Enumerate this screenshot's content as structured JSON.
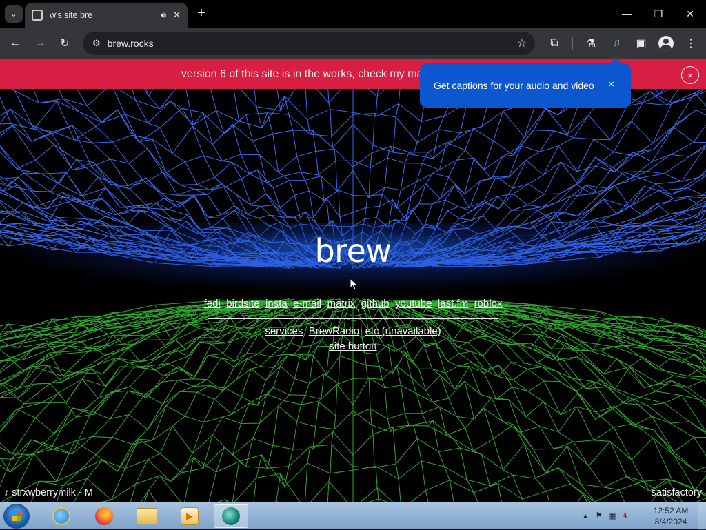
{
  "browser": {
    "tab_title": "w's site bre",
    "url": "brew.rocks",
    "tab_icons": {
      "audio": "speaker-icon",
      "close": "close-icon"
    },
    "window_controls": {
      "minimize": "—",
      "maximize": "❐",
      "close": "✕"
    }
  },
  "banner": {
    "text": "version 6 of this site is in the works, check my mas",
    "close_label": "×"
  },
  "popup": {
    "text": "Get captions for your audio and video",
    "close_label": "×"
  },
  "site": {
    "brand": "brew",
    "links_row1": [
      "fedi",
      "birdsite",
      "insta",
      "e-mail",
      "matrix",
      "github",
      "youtube",
      "last.fm",
      "roblox"
    ],
    "links_row2": [
      "services",
      "BrewRadio",
      "etc (unavailable)"
    ],
    "links_row3": [
      "site button"
    ],
    "now_playing": "strxwberrymilk - M",
    "now_playing_right": "satisfactory"
  },
  "taskbar": {
    "time": "12:52 AM",
    "date": "8/4/2024",
    "tray_arrow": "▴"
  },
  "colors": {
    "banner": "#d71e43",
    "popup": "#0b57d0",
    "wire_top": "#3a6cf0",
    "wire_bottom": "#2fa82f"
  }
}
